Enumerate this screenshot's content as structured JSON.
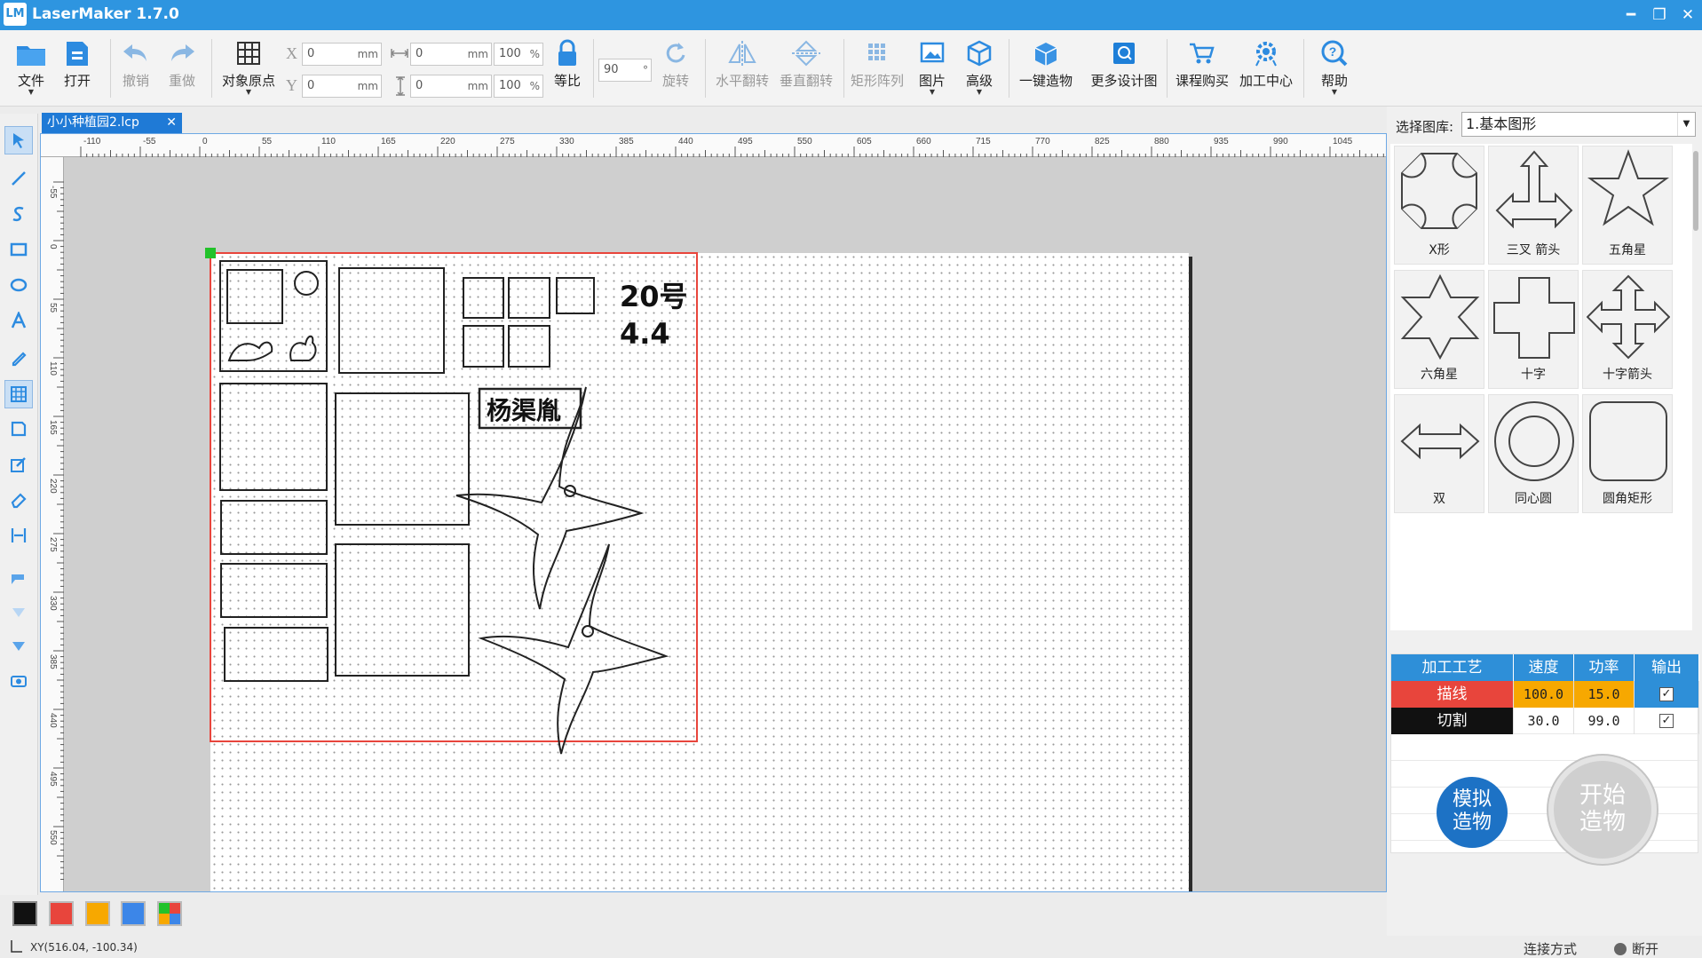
{
  "window": {
    "app_icon_text": "LM",
    "title": "LaserMaker 1.7.0",
    "controls": {
      "minimize": "━",
      "restore": "❐",
      "close": "✕"
    }
  },
  "toolbar": {
    "file": "文件",
    "open": "打开",
    "undo": "撤销",
    "redo": "重做",
    "object_origin": "对象原点",
    "x_label": "X",
    "y_label": "Y",
    "x_value": "0",
    "y_value": "0",
    "width_value": "0",
    "height_value": "0",
    "unit_mm": "mm",
    "scale_w": "100",
    "scale_h": "100",
    "unit_pct": "%",
    "proportional": "等比",
    "rotate_value": "90",
    "rotate_unit": "°",
    "rotate": "旋转",
    "flip_h": "水平翻转",
    "flip_v": "垂直翻转",
    "rect_array": "矩形阵列",
    "image": "图片",
    "advanced": "高级",
    "one_click": "一键造物",
    "more_designs": "更多设计图",
    "course_buy": "课程购买",
    "process_center": "加工中心",
    "help": "帮助"
  },
  "tab": {
    "filename": "小小种植园2.lcp",
    "close": "✕"
  },
  "ruler": {
    "h_ticks": [
      "-110",
      "-55",
      "0",
      "55",
      "110",
      "165",
      "220",
      "275",
      "330",
      "385",
      "440",
      "495",
      "550",
      "605",
      "660",
      "715",
      "770",
      "825",
      "880",
      "935",
      "990",
      "1045"
    ],
    "v_ticks": [
      "-55",
      "0",
      "55",
      "110",
      "165",
      "220",
      "275",
      "330",
      "385",
      "440",
      "495",
      "550"
    ]
  },
  "canvas": {
    "label_line1": "20号",
    "label_line2": "4.4",
    "name_tag": "杨渠胤"
  },
  "palette": {
    "colors": [
      "#111111",
      "#e8453c",
      "#f7a800",
      "#3c86e8"
    ]
  },
  "status": {
    "coords": "XY(516.04, -100.34)",
    "connection_label": "连接方式",
    "connection_state": "断开"
  },
  "library": {
    "label": "选择图库:",
    "selected": "1.基本图形",
    "shapes": [
      "X形",
      "三叉 箭头",
      "五角星",
      "六角星",
      "十字",
      "十字箭头",
      "双",
      "同心圆",
      "圆角矩形"
    ]
  },
  "process_table": {
    "headers": [
      "加工工艺",
      "速度",
      "功率",
      "输出"
    ],
    "rows": [
      {
        "name": "描线",
        "speed": "100.0",
        "power": "15.0",
        "output": "✓",
        "color": "#e8453c"
      },
      {
        "name": "切割",
        "speed": "30.0",
        "power": "99.0",
        "output": "✓",
        "color": "#111111"
      }
    ]
  },
  "buttons": {
    "simulate_line1": "模拟",
    "simulate_line2": "造物",
    "start_line1": "开始",
    "start_line2": "造物"
  }
}
